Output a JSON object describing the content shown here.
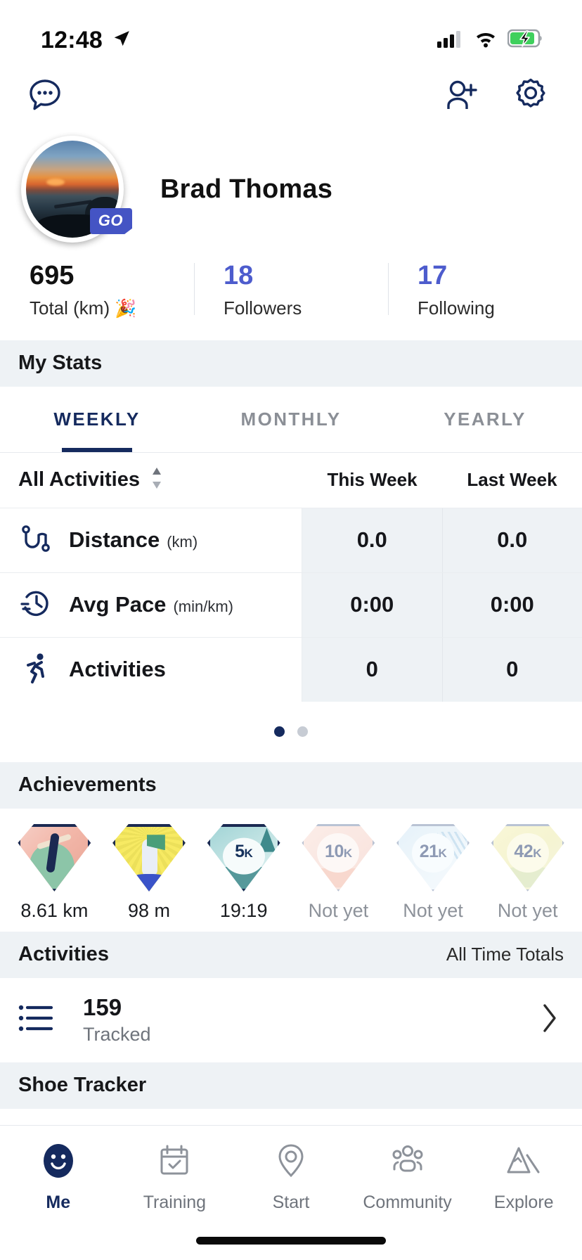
{
  "status_bar": {
    "time": "12:48",
    "location_icon": "location-arrow-icon",
    "signal_icon": "cellular-signal-icon",
    "wifi_icon": "wifi-icon",
    "battery_icon": "battery-charging-icon"
  },
  "top_bar": {
    "messages_icon": "chat-bubble-icon",
    "add_friend_icon": "add-person-icon",
    "settings_icon": "gear-icon"
  },
  "profile": {
    "name": "Brad Thomas",
    "badge": "GO",
    "avatar_icon": "profile-photo-sunset"
  },
  "stats": [
    {
      "value": "695",
      "label": "Total (km)",
      "emoji": "🎉",
      "is_link": false
    },
    {
      "value": "18",
      "label": "Followers",
      "emoji": "",
      "is_link": true
    },
    {
      "value": "17",
      "label": "Following",
      "emoji": "",
      "is_link": true
    }
  ],
  "my_stats": {
    "section_title": "My Stats",
    "tabs": [
      {
        "label": "WEEKLY",
        "active": true
      },
      {
        "label": "MONTHLY",
        "active": false
      },
      {
        "label": "YEARLY",
        "active": false
      }
    ],
    "filter_label": "All Activities",
    "sort_icon": "sort-updown-icon",
    "columns": [
      "This Week",
      "Last Week"
    ],
    "rows": [
      {
        "icon": "route-distance-icon",
        "title": "Distance",
        "unit": "(km)",
        "this_week": "0.0",
        "last_week": "0.0"
      },
      {
        "icon": "clock-pace-icon",
        "title": "Avg Pace",
        "unit": "(min/km)",
        "this_week": "0:00",
        "last_week": "0:00"
      },
      {
        "icon": "running-person-icon",
        "title": "Activities",
        "unit": "",
        "this_week": "0",
        "last_week": "0"
      }
    ],
    "pager": {
      "count": 2,
      "active_index": 0
    }
  },
  "achievements": {
    "section_title": "Achievements",
    "badges": [
      {
        "caption": "8.61 km",
        "medal": "",
        "earned": true,
        "style": "b1"
      },
      {
        "caption": "98 m",
        "medal": "",
        "earned": true,
        "style": "b2"
      },
      {
        "caption": "19:19",
        "medal": "5",
        "medal_sub": "K",
        "earned": true,
        "style": "b3"
      },
      {
        "caption": "Not yet",
        "medal": "10",
        "medal_sub": "K",
        "earned": false,
        "style": "bl10"
      },
      {
        "caption": "Not yet",
        "medal": "21",
        "medal_sub": "K",
        "earned": false,
        "style": "bl21"
      },
      {
        "caption": "Not yet",
        "medal": "42",
        "medal_sub": "K",
        "earned": false,
        "style": "bl42"
      }
    ]
  },
  "activities": {
    "section_title": "Activities",
    "section_right": "All Time Totals",
    "tracked_icon": "list-icon",
    "tracked_count": "159",
    "tracked_label": "Tracked",
    "chevron_icon": "chevron-right-icon"
  },
  "shoe_tracker": {
    "section_title": "Shoe Tracker"
  },
  "bottom_nav": [
    {
      "label": "Me",
      "icon": "smiley-face-icon",
      "active": true
    },
    {
      "label": "Training",
      "icon": "calendar-check-icon",
      "active": false
    },
    {
      "label": "Start",
      "icon": "location-pin-icon",
      "active": false
    },
    {
      "label": "Community",
      "icon": "people-group-icon",
      "active": false
    },
    {
      "label": "Explore",
      "icon": "mountains-icon",
      "active": false
    }
  ],
  "colors": {
    "brand_navy": "#152a5e",
    "link_blue": "#4d5ccd",
    "section_bg": "#eef2f5",
    "cell_bg": "#eef2f5"
  }
}
